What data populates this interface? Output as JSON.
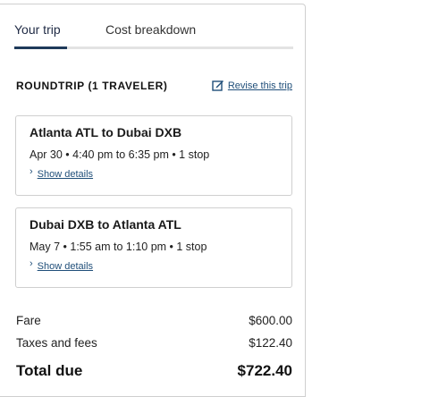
{
  "tabs": [
    {
      "label": "Your trip",
      "active": true
    },
    {
      "label": "Cost breakdown",
      "active": false
    }
  ],
  "trip": {
    "heading": "ROUNDTRIP (1 TRAVELER)",
    "revise_label": "Revise this trip",
    "revise_icon": "edit-icon"
  },
  "flights": [
    {
      "title": "Atlanta ATL to Dubai DXB",
      "summary": "Apr 30 • 4:40 pm to 6:35 pm • 1 stop",
      "details_label": "Show details"
    },
    {
      "title": "Dubai DXB to Atlanta ATL",
      "summary": "May 7 • 1:55 am to 1:10 pm • 1 stop",
      "details_label": "Show details"
    }
  ],
  "costs": {
    "fare_label": "Fare",
    "fare_value": "$600.00",
    "taxes_label": "Taxes and fees",
    "taxes_value": "$122.40",
    "total_label": "Total due",
    "total_value": "$722.40"
  },
  "colors": {
    "link": "#1f4e79",
    "active_tab_indicator": "#1f3a5a",
    "border": "#cfcfcf"
  }
}
